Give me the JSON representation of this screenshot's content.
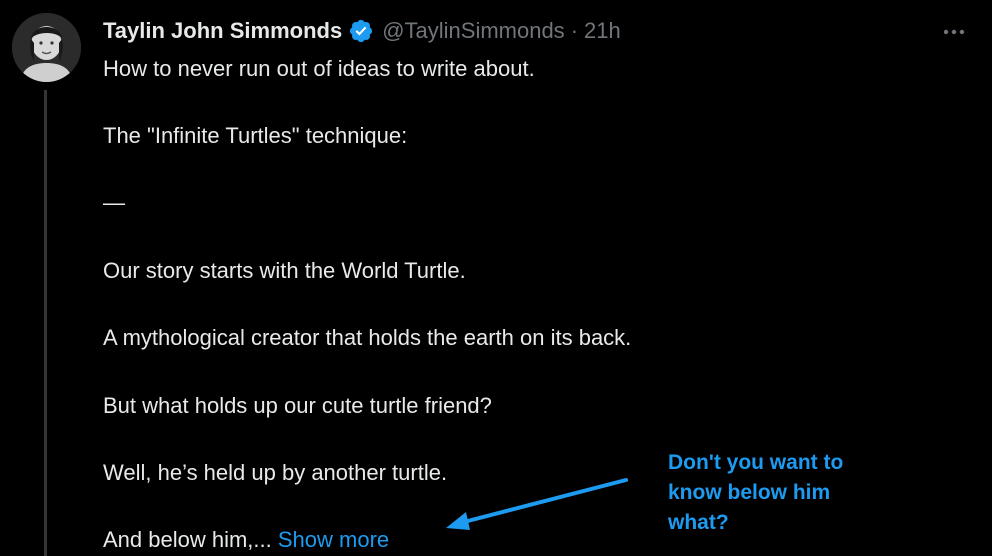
{
  "tweet": {
    "author": {
      "display_name": "Taylin John Simmonds",
      "handle": "@TaylinSimmonds",
      "verified": true,
      "avatar_icon": "user-portrait-icon"
    },
    "separator": "·",
    "timestamp": "21h",
    "more_icon": "more-options-icon",
    "lines": [
      "How to never run out of ideas to write about.",
      "The \"Infinite Turtles\" technique:",
      "—",
      "Our story starts with the World Turtle.",
      "A mythological creator that holds the earth on its back.",
      "But what holds up our cute turtle friend?",
      "Well, he’s held up by another turtle.",
      "And below him,..."
    ],
    "show_more_label": "Show more"
  },
  "annotation": {
    "text": "Don't you want to\nknow below him\nwhat?",
    "color": "#1d9bf0"
  },
  "colors": {
    "background": "#000000",
    "text": "#e7e9ea",
    "muted": "#71767b",
    "accent": "#1d9bf0",
    "thread_line": "#333639"
  }
}
